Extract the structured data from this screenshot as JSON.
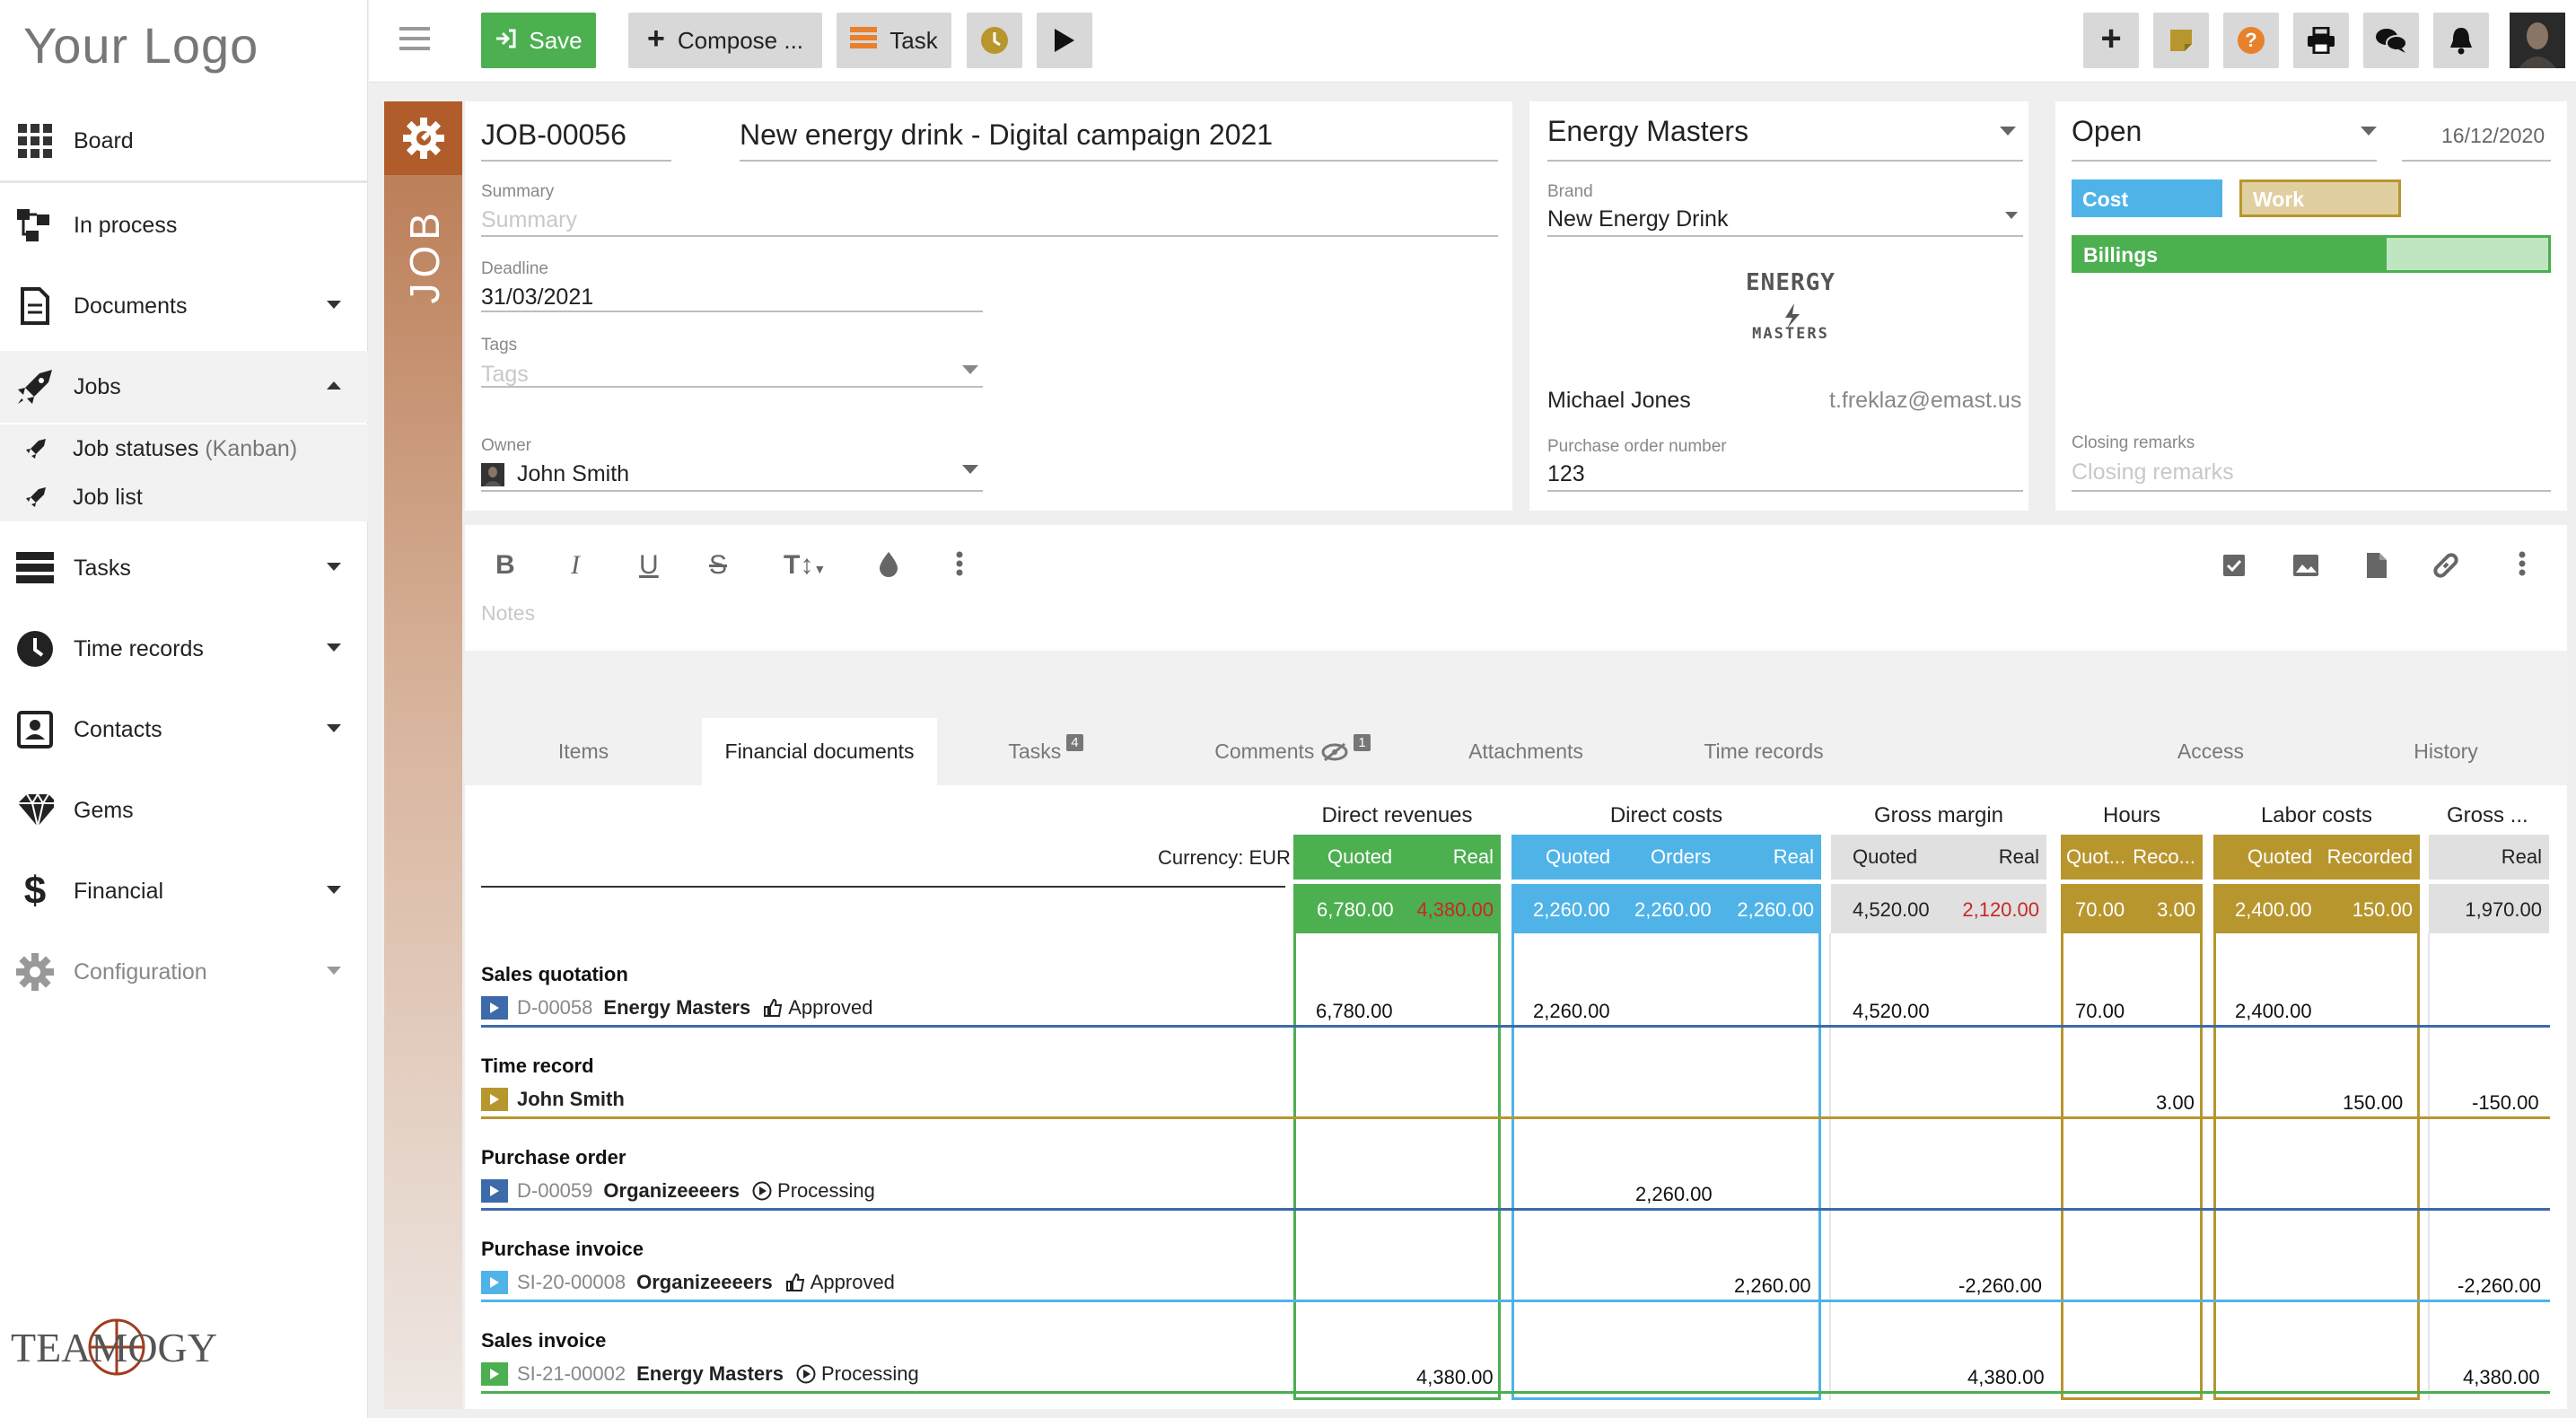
{
  "app": {
    "logo_text": "Your Logo",
    "brand": "TEAMOGY"
  },
  "sidebar": {
    "items": [
      {
        "label": "Board"
      },
      {
        "label": "In process"
      },
      {
        "label": "Documents"
      },
      {
        "label": "Jobs"
      },
      {
        "label": "Tasks"
      },
      {
        "label": "Time records"
      },
      {
        "label": "Contacts"
      },
      {
        "label": "Gems"
      },
      {
        "label": "Financial"
      },
      {
        "label": "Configuration"
      }
    ],
    "jobs_sub": [
      {
        "label": "Job statuses",
        "hint": "(Kanban)"
      },
      {
        "label": "Job list"
      }
    ]
  },
  "toolbar": {
    "save": "Save",
    "compose": "Compose ...",
    "task": "Task"
  },
  "job": {
    "strip_label": "JOB",
    "number": "JOB-00056",
    "title": "New energy drink - Digital campaign 2021",
    "summary_label": "Summary",
    "summary_placeholder": "Summary",
    "deadline_label": "Deadline",
    "deadline": "31/03/2021",
    "tags_label": "Tags",
    "tags_placeholder": "Tags",
    "owner_label": "Owner",
    "owner": "John Smith"
  },
  "client": {
    "name": "Energy Masters",
    "brand_label": "Brand",
    "brand": "New Energy Drink",
    "logo_top": "ENERGY",
    "logo_bottom": "MASTERS",
    "contact_name": "Michael Jones",
    "contact_email": "t.freklaz@emast.us",
    "po_label": "Purchase order number",
    "po": "123"
  },
  "status": {
    "value": "Open",
    "date": "16/12/2020",
    "cost": "Cost",
    "work": "Work",
    "billings": "Billings",
    "billings_progress": 0.66,
    "closing_label": "Closing remarks",
    "closing_placeholder": "Closing remarks"
  },
  "editor": {
    "notes_placeholder": "Notes"
  },
  "tabs": [
    {
      "label": "Items"
    },
    {
      "label": "Financial documents"
    },
    {
      "label": "Tasks",
      "badge": "4"
    },
    {
      "label": "Comments",
      "badge": "1"
    },
    {
      "label": "Attachments"
    },
    {
      "label": "Time records"
    },
    {
      "label": "Access"
    },
    {
      "label": "History"
    }
  ],
  "financial": {
    "currency": "Currency: EUR",
    "groups": {
      "direct_revenues": {
        "title": "Direct revenues",
        "cols": [
          "Quoted",
          "Real"
        ],
        "totals": [
          "6,780.00",
          "4,380.00"
        ]
      },
      "direct_costs": {
        "title": "Direct costs",
        "cols": [
          "Quoted",
          "Orders",
          "Real"
        ],
        "totals": [
          "2,260.00",
          "2,260.00",
          "2,260.00"
        ]
      },
      "gross_margin": {
        "title": "Gross margin",
        "cols": [
          "Quoted",
          "Real"
        ],
        "totals": [
          "4,520.00",
          "2,120.00"
        ]
      },
      "hours": {
        "title": "Hours",
        "cols": [
          "Quot...",
          "Reco..."
        ],
        "totals": [
          "70.00",
          "3.00"
        ]
      },
      "labor_costs": {
        "title": "Labor costs",
        "cols": [
          "Quoted",
          "Recorded"
        ],
        "totals": [
          "2,400.00",
          "150.00"
        ]
      },
      "gross": {
        "title": "Gross ...",
        "cols": [
          "Real"
        ],
        "totals": [
          "1,970.00"
        ]
      }
    },
    "rows": [
      {
        "title": "Sales quotation",
        "doc": "D-00058",
        "party": "Energy Masters",
        "state": "Approved",
        "values": {
          "dr_quoted": "6,780.00",
          "dc_quoted": "2,260.00",
          "gm_quoted": "4,520.00",
          "h_quoted": "70.00",
          "lc_quoted": "2,400.00"
        }
      },
      {
        "title": "Time record",
        "doc": "",
        "party": "John Smith",
        "state": "",
        "values": {
          "h_rec": "3.00",
          "lc_rec": "150.00",
          "gross": "-150.00"
        }
      },
      {
        "title": "Purchase order",
        "doc": "D-00059",
        "party": "Organizeeeers",
        "state": "Processing",
        "values": {
          "dc_orders": "2,260.00"
        }
      },
      {
        "title": "Purchase invoice",
        "doc": "SI-20-00008",
        "party": "Organizeeeers",
        "state": "Approved",
        "values": {
          "dc_real": "2,260.00",
          "gm_real": "-2,260.00",
          "gross": "-2,260.00"
        }
      },
      {
        "title": "Sales invoice",
        "doc": "SI-21-00002",
        "party": "Energy Masters",
        "state": "Processing",
        "values": {
          "dr_real": "4,380.00",
          "gm_real": "4,380.00",
          "gross": "4,380.00"
        }
      }
    ]
  },
  "colors": {
    "green": "#4caf50",
    "blue": "#4fb3e8",
    "gold": "#b8962e",
    "gray": "#e0e0e0",
    "red": "#c62828",
    "orange": "#b05d2b"
  }
}
